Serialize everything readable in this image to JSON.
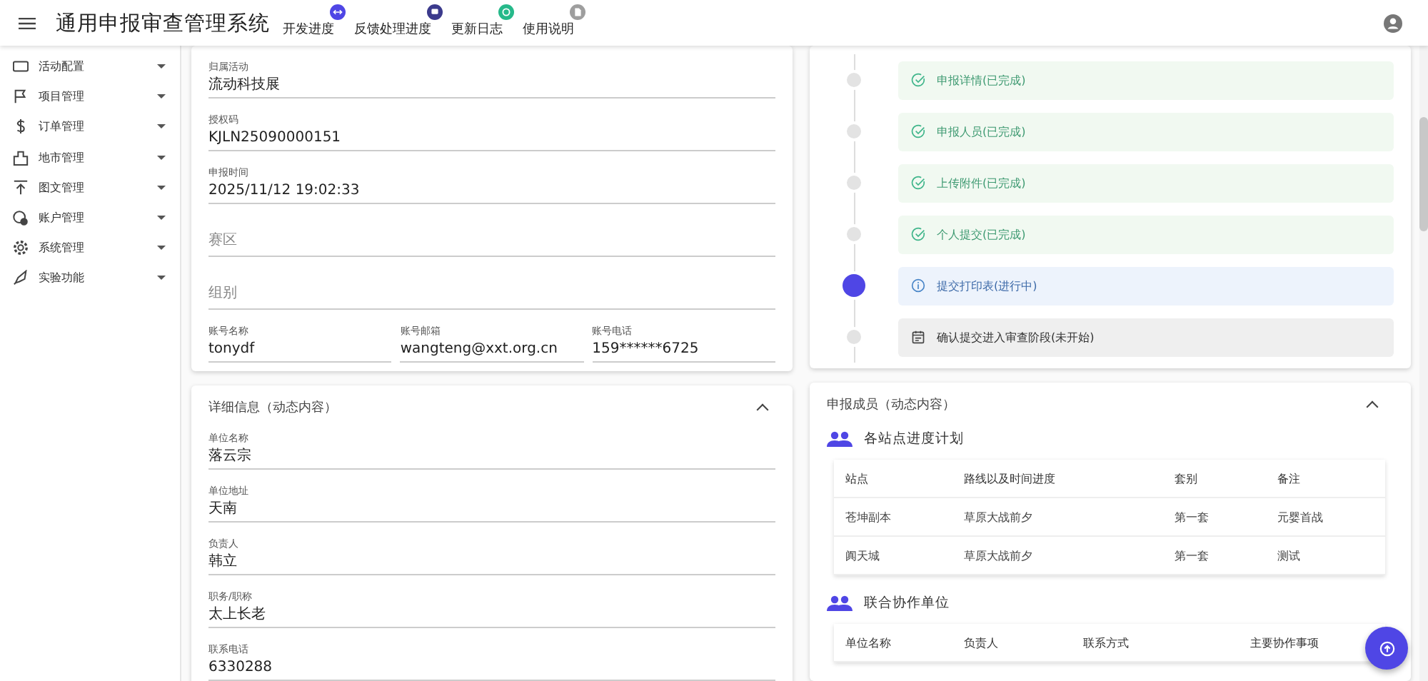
{
  "app_title": "通用申报审查管理系统",
  "nav": [
    {
      "label": "开发进度",
      "color": "#4f46e5"
    },
    {
      "label": "反馈处理进度",
      "color": "#3b3a8c"
    },
    {
      "label": "更新日志",
      "color": "#26b98a"
    },
    {
      "label": "使用说明",
      "color": "#9e9e9e"
    }
  ],
  "sidebar": {
    "items": [
      {
        "label": "活动配置",
        "expanded": false
      },
      {
        "label": "项目管理",
        "expanded": false
      },
      {
        "label": "订单管理",
        "expanded": false
      },
      {
        "label": "地市管理",
        "expanded": false
      },
      {
        "label": "图文管理",
        "expanded": false
      },
      {
        "label": "账户管理",
        "expanded": false
      },
      {
        "label": "系统管理",
        "expanded": false
      },
      {
        "label": "实验功能",
        "expanded": false
      }
    ]
  },
  "basic_fields": [
    {
      "label": "归属活动",
      "value": "流动科技展"
    },
    {
      "label": "授权码",
      "value": "KJLN25090000151"
    },
    {
      "label": "申报时间",
      "value": "2025/11/12 19:02:33"
    },
    {
      "placeholder": "赛区"
    },
    {
      "placeholder": "组别"
    }
  ],
  "account_fields": [
    {
      "label": "账号名称",
      "value": "tonydf"
    },
    {
      "label": "账号邮箱",
      "value": "wangteng@xxt.org.cn"
    },
    {
      "label": "账号电话",
      "value": "159******6725"
    }
  ],
  "detail_panel": {
    "title": "详细信息（动态内容）",
    "expanded": true,
    "fields": [
      {
        "label": "单位名称",
        "value": "落云宗"
      },
      {
        "label": "单位地址",
        "value": "天南"
      },
      {
        "label": "负责人",
        "value": "韩立"
      },
      {
        "label": "职务/职称",
        "value": "太上长老"
      },
      {
        "label": "联系电话",
        "value": "6330288"
      }
    ]
  },
  "timeline": [
    {
      "text": "申报详情(已完成)",
      "kind": "done"
    },
    {
      "text": "申报人员(已完成)",
      "kind": "done"
    },
    {
      "text": "上传附件(已完成)",
      "kind": "done"
    },
    {
      "text": "个人提交(已完成)",
      "kind": "done"
    },
    {
      "text": "提交打印表(进行中)",
      "kind": "active"
    },
    {
      "text": "确认提交进入审查阶段(未开始)",
      "kind": "pending"
    }
  ],
  "members_panel": {
    "title": "申报成员（动态内容）",
    "expanded": true,
    "sections": [
      {
        "title": "各站点进度计划",
        "columns": [
          "站点",
          "路线以及时间进度",
          "套别",
          "备注"
        ],
        "rows": [
          [
            "苍坤副本",
            "草原大战前夕",
            "第一套",
            "元婴首战"
          ],
          [
            "阗天城",
            "草原大战前夕",
            "第一套",
            "测试"
          ]
        ]
      },
      {
        "title": "联合协作单位",
        "columns": [
          "单位名称",
          "负责人",
          "联系方式",
          "主要协作事项"
        ]
      }
    ]
  }
}
